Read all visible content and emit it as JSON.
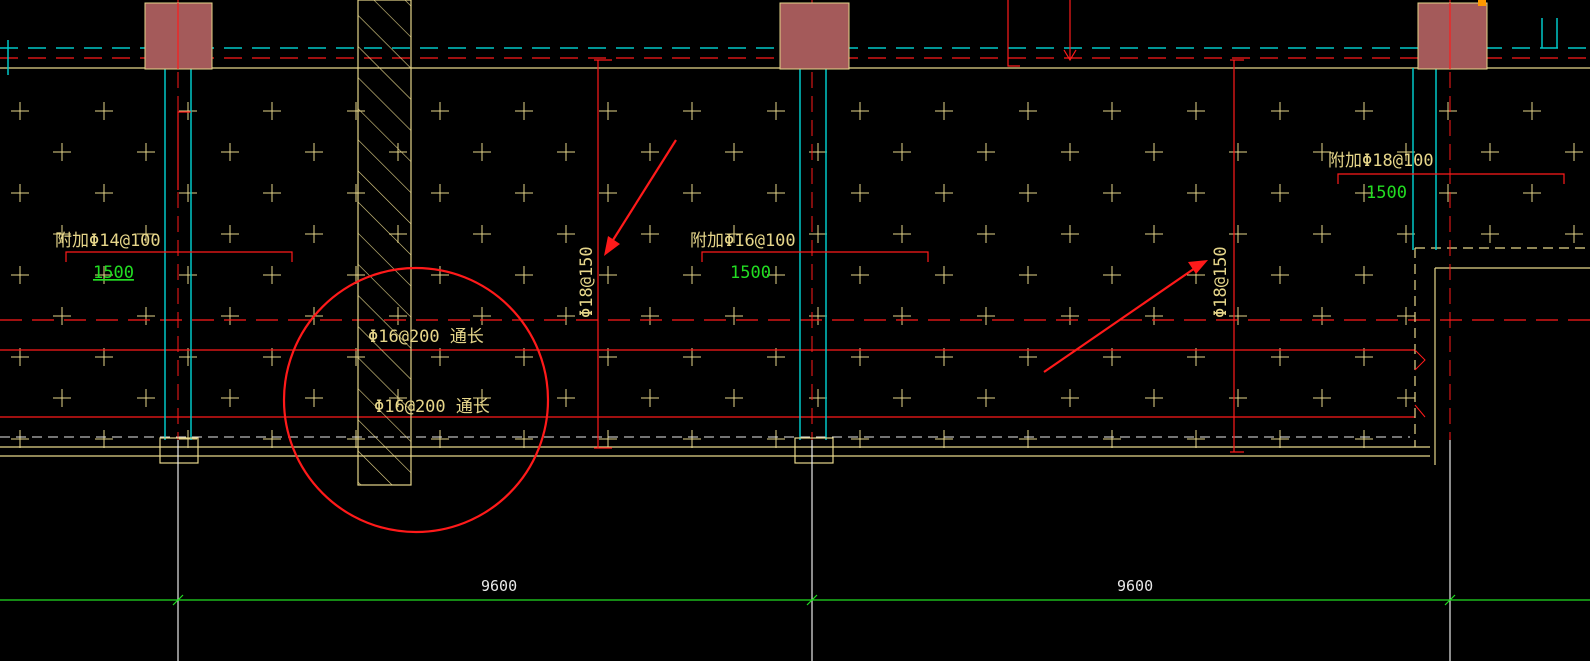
{
  "colors": {
    "background": "#000000",
    "cyan": "#00c8c8",
    "red": "#ff1a1a",
    "yellow": "#e6d68a",
    "green": "#22dd22",
    "column_fill": "#a45a5a",
    "white": "#e8e8e8"
  },
  "labels": {
    "rebar_left_top": "附加Φ14@100",
    "rebar_left_len": "1500",
    "rebar_mid_top": "附加Φ16@100",
    "rebar_mid_len": "1500",
    "rebar_right_top": "附加Φ18@100",
    "rebar_right_len": "1500",
    "vertical_left": "Φ18@150",
    "vertical_right": "Φ18@150",
    "through_upper": "Φ16@200 通长",
    "through_lower": "Φ16@200 通长",
    "dim_left": "9600",
    "dim_right": "9600"
  }
}
